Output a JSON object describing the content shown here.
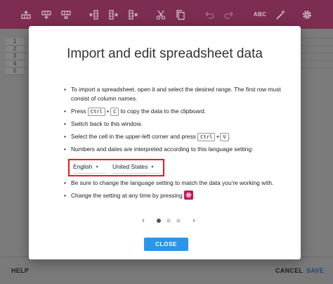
{
  "toolbar": {
    "buttons": [
      "insert-row-icon",
      "insert-row-below-icon",
      "delete-row-icon",
      "insert-column-icon",
      "insert-column-right-icon",
      "delete-column-icon",
      "cut-icon",
      "copy-icon",
      "undo-icon",
      "redo-icon",
      "spellcheck-text",
      "magic-wand-icon",
      "settings-icon"
    ],
    "spellcheck_label": "ABC"
  },
  "sheet": {
    "row_numbers": [
      "1",
      "2",
      "3",
      "4",
      "5"
    ]
  },
  "footer": {
    "help_label": "HELP",
    "cancel_label": "CANCEL",
    "save_label": "SAVE"
  },
  "modal": {
    "title": "Import and edit spreadsheet data",
    "item1": "To import a spreadsheet, open it and select the desired range. The first row must consist of column names.",
    "item2_pre": "Press",
    "item2_key1": "Ctrl",
    "item2_plus": "+",
    "item2_key2": "C",
    "item2_post": "to copy the data to the clipboard.",
    "item3": "Switch back to this window.",
    "item4_pre": "Select the cell in the upper-left corner and press",
    "item4_key1": "Ctrl",
    "item4_plus": "+",
    "item4_key2": "V",
    "item4_post": ".",
    "item5": "Numbers and dates are interpreted according to this language setting:",
    "language_value": "English",
    "country_value": "United States",
    "item6": "Be sure to change the language setting to match the data you're working with.",
    "item7_pre": "Change the setting at any time by pressing",
    "item7_post": ".",
    "pager_prev": "‹",
    "pager_next": "›",
    "close_label": "CLOSE"
  },
  "colors": {
    "toolbar": "#7d2d52",
    "accent_blue": "#2b95e8",
    "highlight_red": "#e21d25",
    "gear_chip": "#c2185b"
  }
}
